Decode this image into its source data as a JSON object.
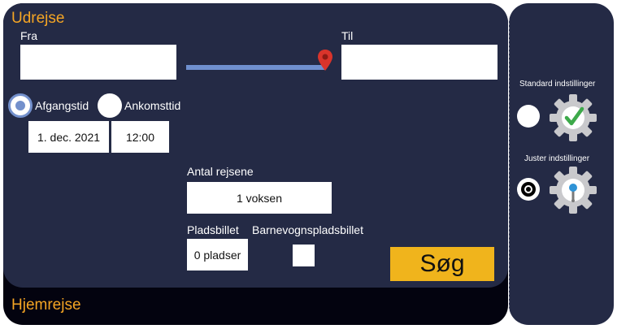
{
  "outbound": {
    "title": "Udrejse",
    "from_label": "Fra",
    "from_value": "",
    "to_label": "Til",
    "to_value": "",
    "departure_label": "Afgangstid",
    "arrival_label": "Ankomsttid",
    "date_value": "1. dec. 2021",
    "time_value": "12:00",
    "travelers_label": "Antal rejsene",
    "travelers_value": "1 voksen",
    "seat_label": "Pladsbillet",
    "seat_value": "0 pladser",
    "stroller_label": "Barnevognspladsbillet",
    "search_label": "Søg"
  },
  "return_trip": {
    "title": "Hjemrejse"
  },
  "settings": {
    "standard_label": "Standard indstillinger",
    "custom_label": "Juster indstillinger"
  },
  "colors": {
    "accent": "#f5a524",
    "panel": "#242a45",
    "search_button": "#f0b41c",
    "route_line": "#6f8fce",
    "pin": "#d9342b",
    "check": "#3da94a"
  }
}
